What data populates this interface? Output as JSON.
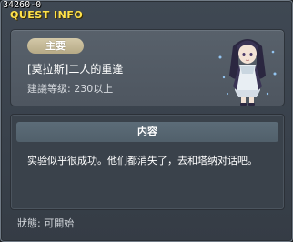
{
  "header": {
    "quest_id": "34260-0",
    "title": "QUEST INFO"
  },
  "quest": {
    "badge": "主要",
    "name": "[莫拉斯]二人的重逢",
    "level": "建議等级: 230以上"
  },
  "content": {
    "header": "内容",
    "text": "实验似乎很成功。他们都消失了，去和塔纳对话吧。"
  },
  "status": "狀態: 可開始",
  "colors": {
    "title": "#ffe24a",
    "badge": "#c9bd9a",
    "panel": "#58616b",
    "content_header": "#5c6c78"
  },
  "icons": {
    "portrait": "npc-portrait-icon"
  }
}
